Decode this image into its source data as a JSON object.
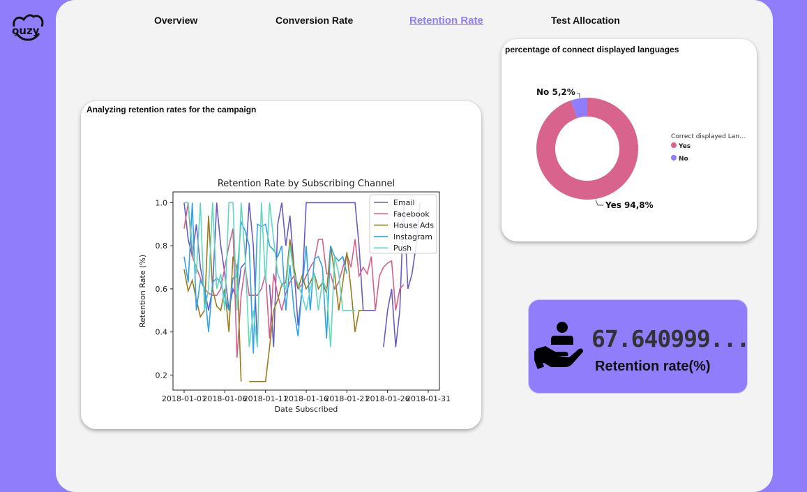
{
  "logo": {
    "text": "ǫuzy"
  },
  "nav": {
    "tabs": [
      {
        "label": "Overview"
      },
      {
        "label": "Conversion Rate"
      },
      {
        "label": "Retention Rate"
      },
      {
        "label": "Test Allocation"
      }
    ],
    "active": "Retention Rate"
  },
  "retention_card": {
    "title": "Analyzing retention rates for the campaign"
  },
  "language_card": {
    "title": "percentage of connect displayed languages"
  },
  "kpi": {
    "value": "67.640999...",
    "label": "Retention rate(%)"
  },
  "colors": {
    "accent": "#8f7dfb",
    "Email": "#6a5bc2",
    "Facebook": "#d4608a",
    "House Ads": "#9a7a1a",
    "Instagram": "#2fa3e6",
    "Push": "#5fd8c0",
    "pie_yes": "#d8638c",
    "pie_no": "#8f7dfb"
  },
  "chart_data": [
    {
      "type": "line",
      "title": "Retention Rate by Subscribing Channel",
      "xlabel": "Date Subscribed",
      "ylabel": "Retention Rate (%)",
      "x_ticks": [
        "2018-01-01",
        "2018-01-06",
        "2018-01-11",
        "2018-01-16",
        "2018-01-21",
        "2018-01-26",
        "2018-01-31"
      ],
      "y_ticks": [
        "0.2",
        "0.4",
        "0.6",
        "0.8",
        "1.0"
      ],
      "ylim": [
        0.13,
        1.05
      ],
      "x_range": [
        1,
        31
      ],
      "legend": "top-right",
      "series": [
        {
          "name": "Email",
          "x": [
            1,
            1.5,
            2,
            2.5,
            3,
            3.5,
            4,
            4.5,
            5,
            5.5,
            6,
            6.5,
            7,
            7.5,
            8,
            8.5,
            9,
            9.5,
            10,
            10.5,
            11,
            11.5,
            12,
            12.5,
            13,
            13.5,
            14,
            14.5,
            15,
            15.5,
            16,
            16.5,
            17,
            17.5,
            18,
            18.5,
            19,
            19.5,
            20,
            20.5,
            21,
            21.5,
            22,
            22.5,
            23,
            23.5,
            24,
            24.5,
            25,
            25.5,
            26,
            26.5,
            27,
            27.5,
            28,
            28.5,
            29,
            29.5,
            30,
            30.5
          ],
          "values": [
            1.0,
            0.83,
            0.75,
            0.9,
            0.7,
            0.6,
            0.5,
            0.6,
            1.0,
            0.8,
            0.67,
            0.5,
            0.6,
            0.55,
            0.7,
            0.72,
            1.0,
            0.8,
            0.33,
            null,
            null,
            0.62,
            0.33,
            0.9,
            1.0,
            0.8,
            0.94,
            0.7,
            0.43,
            0.6,
            1.0,
            1.0,
            1.0,
            1.0,
            1.0,
            1.0,
            1.0,
            1.0,
            1.0,
            1.0,
            1.0,
            1.0,
            1.0,
            0.8,
            0.5,
            0.5,
            0.5,
            0.5,
            null,
            0.33,
            0.5,
            0.6,
            0.33,
            0.5,
            1.0,
            0.6,
            0.67,
            0.8,
            1.0,
            null
          ]
        },
        {
          "name": "Facebook",
          "x": [
            1,
            1.5,
            2,
            2.5,
            3,
            3.5,
            4,
            4.5,
            5,
            5.5,
            6,
            6.5,
            7,
            7.5,
            8,
            8.5,
            9,
            9.5,
            10,
            10.5,
            11,
            11.5,
            12,
            12.5,
            13,
            13.5,
            14,
            14.5,
            15,
            15.5,
            16,
            16.5,
            17,
            17.5,
            18,
            18.5,
            19,
            19.5,
            20,
            20.5,
            21,
            21.5,
            22,
            22.5,
            23,
            23.5,
            24,
            24.5,
            25,
            25.5,
            26,
            26.5,
            27,
            27.5,
            28,
            28.5,
            29,
            29.5,
            30,
            30.5
          ],
          "values": [
            0.88,
            1.0,
            0.75,
            0.7,
            0.65,
            0.6,
            0.58,
            0.57,
            0.57,
            0.6,
            0.7,
            0.8,
            0.88,
            0.28,
            0.57,
            0.7,
            0.57,
            0.57,
            0.57,
            0.6,
            0.67,
            0.37,
            0.67,
            0.57,
            0.5,
            0.58,
            0.63,
            0.66,
            0.6,
            0.62,
            0.66,
            0.7,
            0.73,
            0.83,
            0.83,
            0.67,
            0.67,
            0.6,
            0.63,
            0.7,
            0.76,
            0.7,
            0.83,
            0.66,
            0.7,
            0.67,
            0.75,
            0.5,
            0.66,
            0.7,
            0.72,
            0.73,
            0.5,
            0.6,
            0.62,
            null,
            null,
            null,
            null,
            null
          ]
        },
        {
          "name": "House Ads",
          "x": [
            1,
            1.5,
            2,
            2.5,
            3,
            3.5,
            4,
            4.5,
            5,
            5.5,
            6,
            6.5,
            7,
            7.5,
            8,
            8.5,
            9,
            9.5,
            10,
            10.5,
            11,
            11.5,
            12,
            12.5,
            13,
            13.5,
            14,
            14.5,
            15,
            15.5,
            16,
            16.5,
            17,
            17.5,
            18,
            18.5,
            19,
            19.5,
            20,
            20.5,
            21,
            21.5,
            22,
            22.5,
            23,
            23.5,
            24,
            24.5,
            25,
            25.5,
            26,
            26.5,
            27,
            27.5,
            28,
            28.5,
            29,
            29.5,
            30,
            30.5
          ],
          "values": [
            0.69,
            0.59,
            0.64,
            0.55,
            0.47,
            0.5,
            0.94,
            0.6,
            0.52,
            0.5,
            0.6,
            0.4,
            0.75,
            0.7,
            0.17,
            null,
            0.17,
            0.17,
            0.17,
            0.17,
            0.17,
            0.33,
            0.5,
            0.55,
            0.62,
            0.63,
            0.83,
            0.7,
            0.6,
            0.66,
            0.6,
            0.63,
            0.67,
            0.6,
            0.63,
            0.58,
            0.8,
            0.67,
            0.5,
            0.63,
            0.77,
            0.6,
            0.4,
            0.5,
            0.5,
            null,
            null,
            null,
            null,
            null,
            null,
            null,
            null,
            null,
            null,
            null,
            null,
            null,
            null,
            null
          ]
        },
        {
          "name": "Instagram",
          "x": [
            1,
            1.5,
            2,
            2.5,
            3,
            3.5,
            4,
            4.5,
            5,
            5.5,
            6,
            6.5,
            7,
            7.5,
            8,
            8.5,
            9,
            9.5,
            10,
            10.5,
            11,
            11.5,
            12,
            12.5,
            13,
            13.5,
            14,
            14.5,
            15,
            15.5,
            16,
            16.5,
            17,
            17.5,
            18,
            18.5,
            19,
            19.5,
            20,
            20.5,
            21,
            21.5,
            22,
            22.5,
            23,
            23.5,
            24,
            24.5,
            25,
            25.5,
            26,
            26.5,
            27,
            27.5,
            28,
            28.5,
            29,
            29.5,
            30,
            30.5
          ],
          "values": [
            0.75,
            0.63,
            1.0,
            0.5,
            0.64,
            0.6,
            0.4,
            0.63,
            0.65,
            0.63,
            0.56,
            0.5,
            0.65,
            0.66,
            0.91,
            0.87,
            0.8,
            0.3,
            0.9,
            0.89,
            0.9,
            0.8,
            0.78,
            0.75,
            0.8,
            0.5,
            0.71,
            0.5,
            0.38,
            0.6,
            0.8,
            0.5,
            0.74,
            0.75,
            0.7,
            0.37,
            0.8,
            0.75,
            0.73,
            0.75,
            0.67,
            null,
            null,
            null,
            null,
            null,
            null,
            null,
            null,
            null,
            null,
            null,
            null,
            null,
            null,
            null,
            null,
            null,
            null,
            null
          ]
        },
        {
          "name": "Push",
          "x": [
            1,
            1.5,
            2,
            2.5,
            3,
            3.5,
            4,
            4.5,
            5,
            5.5,
            6,
            6.5,
            7,
            7.5,
            8,
            8.5,
            9,
            9.5,
            10,
            10.5,
            11,
            11.5,
            12,
            12.5,
            13,
            13.5,
            14,
            14.5,
            15,
            15.5,
            16,
            16.5,
            17,
            17.5,
            18,
            18.5,
            19,
            19.5,
            20,
            20.5,
            21,
            21.5,
            22,
            22.5,
            23,
            23.5,
            24,
            24.5,
            25,
            25.5,
            26,
            26.5,
            27,
            27.5,
            28,
            28.5,
            29,
            29.5,
            30,
            30.5
          ],
          "values": [
            1.0,
            1.0,
            0.8,
            0.67,
            1.0,
            0.5,
            0.6,
            1.0,
            0.6,
            0.67,
            0.5,
            1.0,
            1.0,
            0.5,
            1.0,
            0.75,
            0.33,
            0.5,
            0.33,
            1.0,
            0.63,
            1.0,
            0.83,
            0.67,
            0.62,
            0.6,
            0.8,
            0.67,
            0.62,
            0.57,
            0.5,
            0.6,
            0.67,
            0.5,
            0.64,
            0.6,
            0.33,
            0.75,
            0.67,
            0.5,
            0.5,
            0.5,
            0.5,
            null,
            null,
            null,
            null,
            null,
            null,
            null,
            null,
            null,
            null,
            null,
            null,
            null,
            null,
            null,
            null,
            null
          ]
        }
      ]
    },
    {
      "type": "pie",
      "title": "percentage of connect displayed languages",
      "legend_title": "Correct displayed Lan...",
      "categories": [
        "Yes",
        "No"
      ],
      "values": [
        94.8,
        5.2
      ],
      "data_labels": [
        "Yes 94,8%",
        "No 5,2%"
      ],
      "donut": true,
      "legend": "right"
    }
  ]
}
